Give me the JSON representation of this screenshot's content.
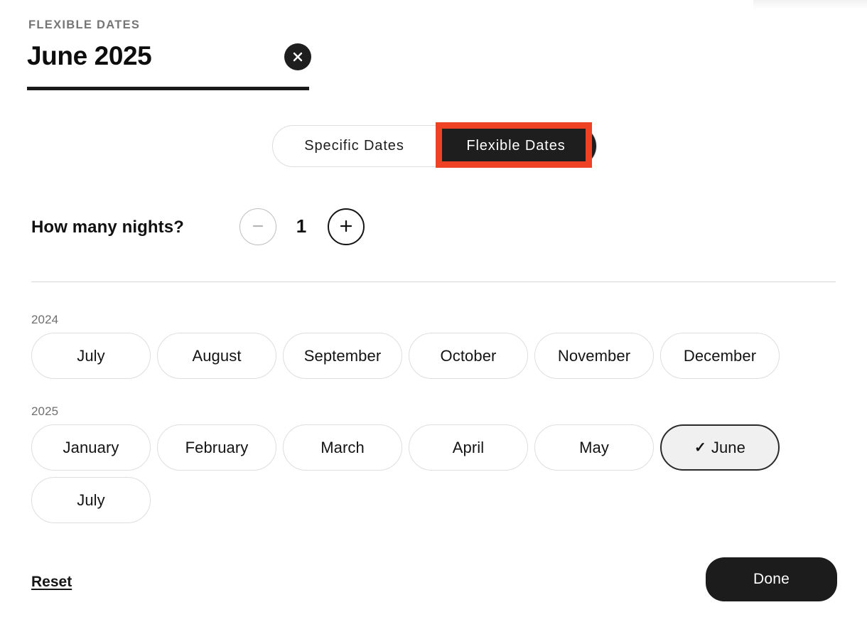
{
  "header": {
    "eyebrow": "FLEXIBLE DATES",
    "title": "June 2025",
    "close_icon": "close-x-icon"
  },
  "tabs": {
    "items": [
      {
        "label": "Specific Dates",
        "active": false
      },
      {
        "label": "Flexible Dates",
        "active": true
      }
    ],
    "specific_label": "Specific Dates",
    "flexible_label": "Flexible Dates"
  },
  "annotation": {
    "target": "Flexible Dates",
    "color": "#ef4123"
  },
  "nights": {
    "label": "How many nights?",
    "value": "1",
    "minus_icon": "minus-icon",
    "plus_icon": "plus-icon",
    "minus_enabled": false,
    "plus_enabled": true
  },
  "months": {
    "groups": [
      {
        "year": "2024",
        "items": [
          {
            "label": "July",
            "selected": false
          },
          {
            "label": "August",
            "selected": false
          },
          {
            "label": "September",
            "selected": false
          },
          {
            "label": "October",
            "selected": false
          },
          {
            "label": "November",
            "selected": false
          },
          {
            "label": "December",
            "selected": false
          }
        ]
      },
      {
        "year": "2025",
        "items": [
          {
            "label": "January",
            "selected": false
          },
          {
            "label": "February",
            "selected": false
          },
          {
            "label": "March",
            "selected": false
          },
          {
            "label": "April",
            "selected": false
          },
          {
            "label": "May",
            "selected": false
          },
          {
            "label": "June",
            "selected": true
          },
          {
            "label": "July",
            "selected": false
          }
        ]
      }
    ],
    "check_icon": "check-icon",
    "selected_month": "June",
    "selected_year": "2025"
  },
  "footer": {
    "reset_label": "Reset",
    "done_label": "Done"
  },
  "colors": {
    "accent_dark": "#1c1c1c",
    "annotation_red": "#ef4123",
    "chip_selected_bg": "#f0f0f0",
    "muted_text": "#767676"
  }
}
